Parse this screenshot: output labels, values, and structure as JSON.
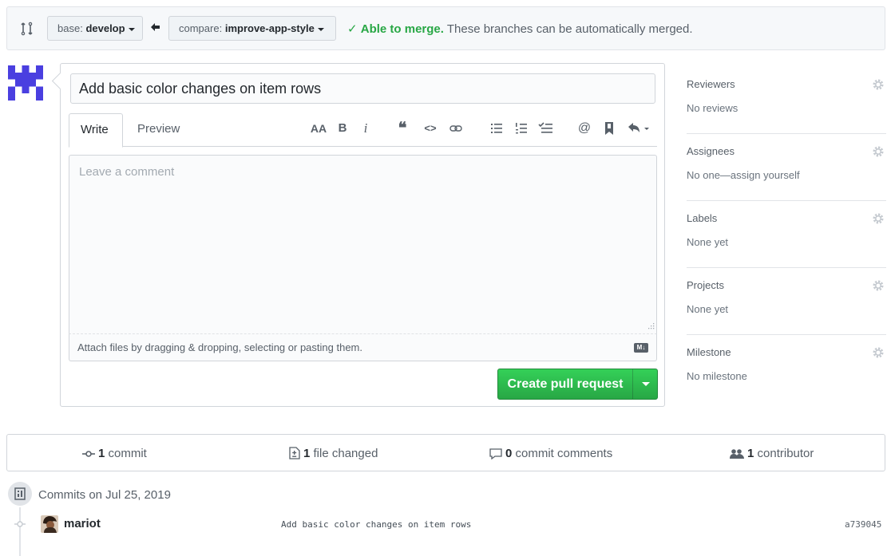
{
  "compare": {
    "base_prefix": "base:",
    "base_branch": "develop",
    "compare_prefix": "compare:",
    "compare_branch": "improve-app-style",
    "merge_ok": "Able to merge.",
    "merge_text": "These branches can be automatically merged."
  },
  "form": {
    "title_value": "Add basic color changes on item rows",
    "tab_write": "Write",
    "tab_preview": "Preview",
    "toolbar": {
      "header": "AA",
      "bold": "B",
      "italic": "i",
      "quote": "66",
      "code": "<>",
      "link": "link-icon",
      "unordered_list": "bulleted-list-icon",
      "ordered_list": "numbered-list-icon",
      "task_list": "task-list-icon",
      "mention": "@",
      "reference": "bookmark-icon",
      "reply": "reply-icon"
    },
    "comment_placeholder": "Leave a comment",
    "attach_text": "Attach files by dragging & dropping, selecting or pasting them.",
    "markdown_badge": "M↓",
    "submit_label": "Create pull request"
  },
  "sidebar": {
    "sections": [
      {
        "title": "Reviewers",
        "value": "No reviews"
      },
      {
        "title": "Assignees",
        "value": "No one—assign yourself"
      },
      {
        "title": "Labels",
        "value": "None yet"
      },
      {
        "title": "Projects",
        "value": "None yet"
      },
      {
        "title": "Milestone",
        "value": "No milestone"
      }
    ]
  },
  "numbers": {
    "commits_count": "1",
    "commits_label": "commit",
    "files_count": "1",
    "files_label": "file changed",
    "comments_count": "0",
    "comments_label": "commit comments",
    "contributors_count": "1",
    "contributors_label": "contributor"
  },
  "commits": {
    "heading": "Commits on Jul 25, 2019",
    "items": [
      {
        "author": "mariot",
        "message": "Add basic color changes on item rows",
        "sha": "a739045"
      }
    ]
  },
  "colors": {
    "accent_green": "#28a745",
    "avatar_blue": "#4a3fe0"
  }
}
